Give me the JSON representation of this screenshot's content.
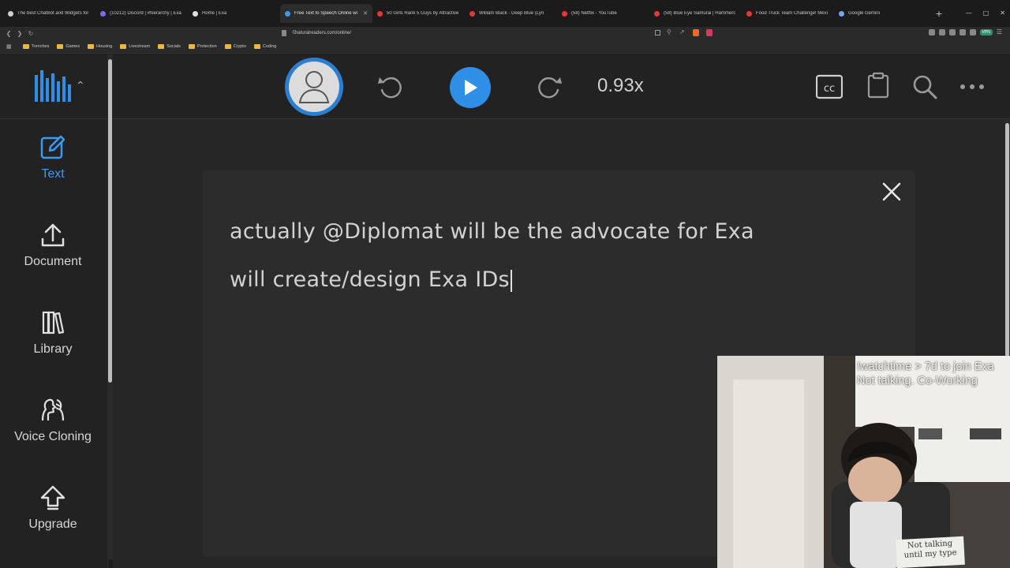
{
  "browser": {
    "tabs": [
      {
        "title": "The best ChatBot and Widgets for",
        "color": "#cfcfcf",
        "active": false
      },
      {
        "title": "(10212) Discord | #hierarchy | Exa",
        "color": "#7b6cf0",
        "active": false
      },
      {
        "title": "Home | Exa",
        "color": "#e0e0e0",
        "active": false
      },
      {
        "title": "Free Text to Speech Online wi",
        "color": "#3b9af0",
        "active": true
      },
      {
        "title": "50 Girls Rank 5 Guys by Attractive",
        "color": "#e53935",
        "active": false
      },
      {
        "title": "William Black - Deep Blue (Lyri",
        "color": "#e53935",
        "active": false
      },
      {
        "title": "(58) Netflix - YouTube",
        "color": "#e53935",
        "active": false
      },
      {
        "title": "(58) Blue Eye Samurai | Hammerc",
        "color": "#e53935",
        "active": false
      },
      {
        "title": "Food Truck Team Challenge! Mexi",
        "color": "#e53935",
        "active": false
      },
      {
        "title": "Google Gemini",
        "color": "#6fa8f5",
        "active": false
      }
    ],
    "new_tab": "+",
    "url": "naturalreaders.com/online/",
    "vpn_label": "VPN",
    "bookmarks": [
      "Trenches",
      "Games",
      "Housing",
      "Livestream",
      "Socials",
      "Protection",
      "Crypto",
      "Coding"
    ]
  },
  "sidebar": {
    "items": [
      {
        "label": "Text",
        "icon": "pencil-square-icon"
      },
      {
        "label": "Document",
        "icon": "upload-icon"
      },
      {
        "label": "Library",
        "icon": "books-icon"
      },
      {
        "label": "Voice Cloning",
        "icon": "voice-cloning-icon"
      },
      {
        "label": "Upgrade",
        "icon": "upgrade-arrow-icon"
      }
    ]
  },
  "toolbar": {
    "speed": "0.93x"
  },
  "editor": {
    "lines": [
      "actually @Diplomat will be the advocate for Exa",
      "will create/design Exa IDs"
    ]
  },
  "stream_overlay": {
    "line1": "!watchtime > 7d to join Exa",
    "line2": "Not talking. Co-Working",
    "note_line1": "Not talking",
    "note_line2": "until my type"
  },
  "colors": {
    "accent": "#2f8fe6",
    "active_nav": "#3b9af0"
  }
}
